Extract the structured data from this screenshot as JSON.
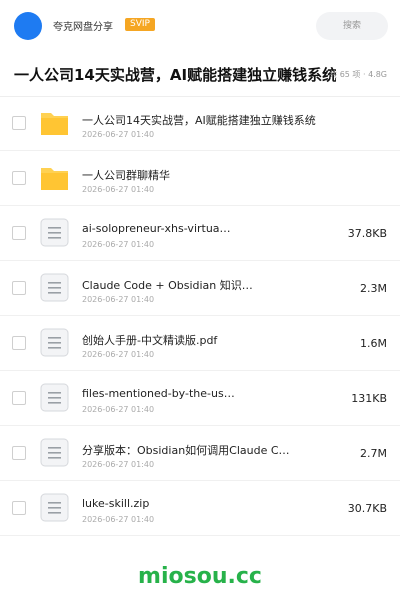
{
  "header": {
    "brand": "夸克网盘分享",
    "badge": "SVIP",
    "search_label": "搜索"
  },
  "share": {
    "title": "一人公司14天实战营，AI赋能搭建独立赚钱系统",
    "meta": "共 65 项 · 4.8G"
  },
  "files": [
    {
      "name": "一人公司14天实战营，AI赋能搭建独立赚钱系统",
      "date": "2026-06-27 01:40",
      "size": "",
      "icon": "folder-icon"
    },
    {
      "name": "一人公司群聊精华",
      "date": "2026-06-27 01:40",
      "size": "",
      "icon": "folder-icon"
    },
    {
      "name": "ai-solopreneur-xhs-virtua…",
      "date": "2026-06-27 01:40",
      "size": "37.8KB",
      "icon": "file-icon"
    },
    {
      "name": "Claude Code + Obsidian 知识…",
      "date": "2026-06-27 01:40",
      "size": "2.3M",
      "icon": "file-icon"
    },
    {
      "name": "创始人手册-中文精读版.pdf",
      "date": "2026-06-27 01:40",
      "size": "1.6M",
      "icon": "file-icon"
    },
    {
      "name": "files-mentioned-by-the-us…",
      "date": "2026-06-27 01:40",
      "size": "131KB",
      "icon": "file-icon"
    },
    {
      "name": "分享版本：Obsidian如何调用Claude C…",
      "date": "2026-06-27 01:40",
      "size": "2.7M",
      "icon": "file-icon"
    },
    {
      "name": "luke-skill.zip",
      "date": "2026-06-27 01:40",
      "size": "30.7KB",
      "icon": "file-icon"
    }
  ],
  "watermark": "miosou.cc",
  "colors": {
    "accent": "#1e7bf2",
    "svip": "#f5a623",
    "folder": "#ffc533",
    "watermark": "#27b24a"
  }
}
